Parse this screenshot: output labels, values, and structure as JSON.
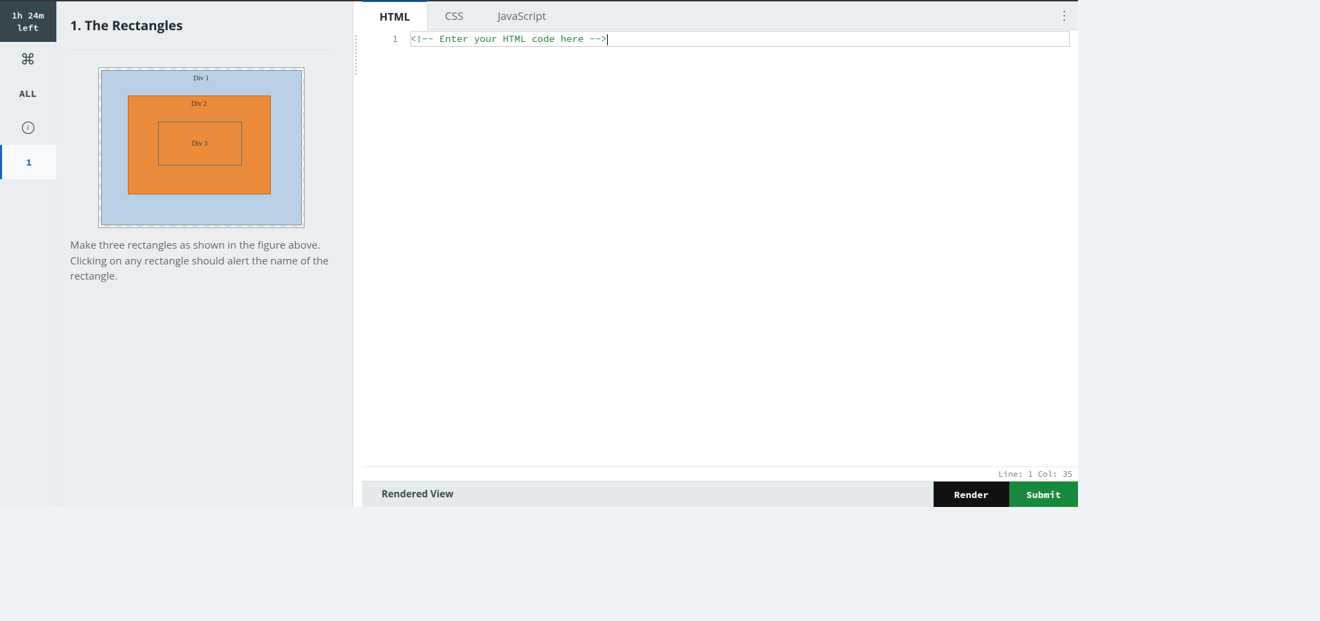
{
  "timer": {
    "line1": "1h 24m",
    "line2": "left"
  },
  "sidebar": {
    "all_label": "ALL",
    "question_number": "1"
  },
  "problem": {
    "title": "1. The Rectangles",
    "div1_label": "Div 1",
    "div2_label": "Div 2",
    "div3_label": "Div 3",
    "description": "Make three rectangles as shown in the figure above. Clicking on any rectangle should alert the name of the rectangle."
  },
  "editor": {
    "tabs": {
      "html": "HTML",
      "css": "CSS",
      "js": "JavaScript"
    },
    "gutter_line": "1",
    "code_line_1": "<!-- Enter your HTML code here -->",
    "status": "Line: 1 Col: 35"
  },
  "footer": {
    "rendered_label": "Rendered View",
    "render_button": "Render",
    "submit_button": "Submit"
  }
}
